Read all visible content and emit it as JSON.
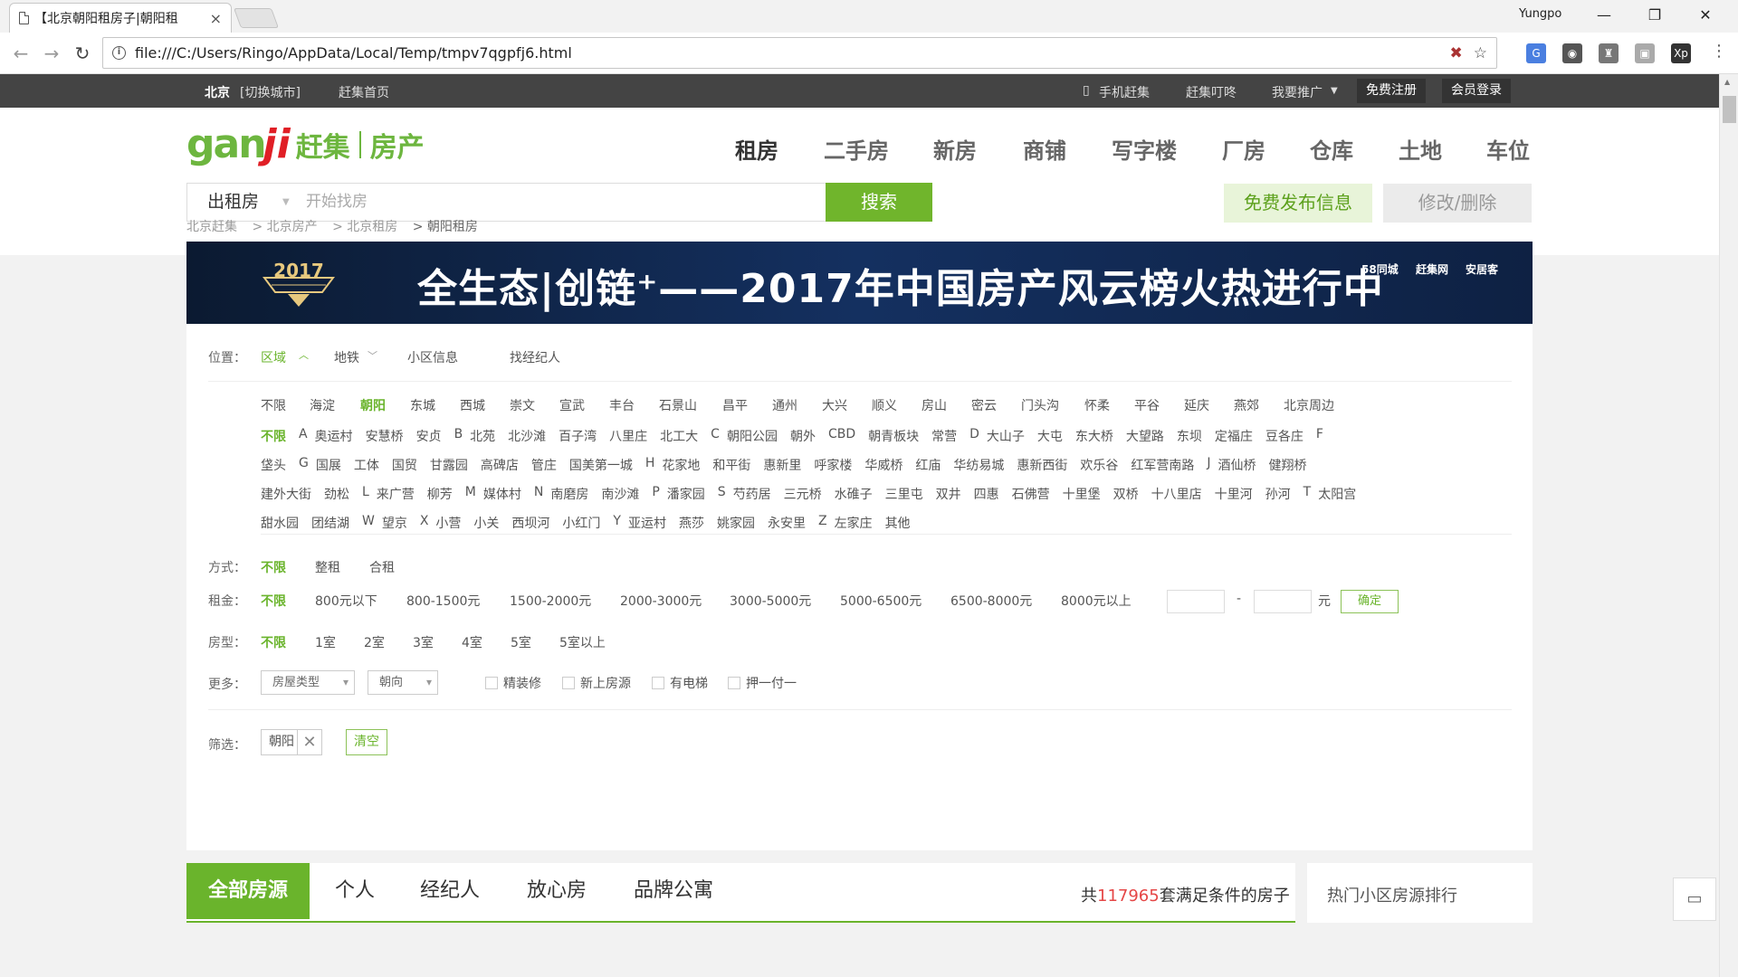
{
  "browser": {
    "tab_title": "【北京朝阳租房子|朝阳租",
    "tab_close": "×",
    "user": "Yungpo",
    "minimize": "—",
    "restore": "❐",
    "close": "✕",
    "url": "file:///C:/Users/Ringo/AppData/Local/Temp/tmpv7qgpfj6.html",
    "icons": [
      "back-icon",
      "forward-icon",
      "reload-icon",
      "info-icon",
      "blocked-plugin-icon",
      "bookmark-star-icon",
      "translate-icon",
      "extension-icon",
      "menu-icon"
    ]
  },
  "topbar": {
    "city": "北京",
    "switch_city": "[切换城市]",
    "home": "赶集首页",
    "mobile": "手机赶集",
    "dingdong": "赶集叮咚",
    "promote": "我要推广",
    "register": "免费注册",
    "login": "会员登录"
  },
  "logo": {
    "gan": "gan",
    "ji": "ji",
    "ganji": "赶集",
    "fangchan": "房产"
  },
  "main_nav": [
    "租房",
    "二手房",
    "新房",
    "商铺",
    "写字楼",
    "厂房",
    "仓库",
    "土地",
    "车位"
  ],
  "search": {
    "type": "出租房",
    "placeholder": "开始找房",
    "button": "搜索",
    "publish": "免费发布信息",
    "edit": "修改/删除"
  },
  "breadcrumb": [
    "北京赶集",
    "> 北京房产",
    "> 北京租房",
    "> 朝阳租房"
  ],
  "banner": {
    "year": "2017",
    "main": "全生态|创链⁺——2017年中国房产风云榜火热进行中",
    "logos": [
      "58同城",
      "赶集网",
      "安居客"
    ]
  },
  "filters": {
    "location_label": "位置：",
    "location_tabs": [
      "区域",
      "地铁",
      "小区信息",
      "找经纪人"
    ],
    "districts": [
      "不限",
      "海淀",
      "朝阳",
      "东城",
      "西城",
      "崇文",
      "宣武",
      "丰台",
      "石景山",
      "昌平",
      "通州",
      "大兴",
      "顺义",
      "房山",
      "密云",
      "门头沟",
      "怀柔",
      "平谷",
      "延庆",
      "燕郊",
      "北京周边"
    ],
    "area_rows": [
      [
        "不限",
        "A",
        "奥运村",
        "安慧桥",
        "安贞",
        "B",
        "北苑",
        "北沙滩",
        "百子湾",
        "八里庄",
        "北工大",
        "C",
        "朝阳公园",
        "朝外",
        "CBD",
        "朝青板块",
        "常营",
        "D",
        "大山子",
        "大屯",
        "东大桥",
        "大望路",
        "东坝",
        "定福庄",
        "豆各庄",
        "F"
      ],
      [
        "垡头",
        "G",
        "国展",
        "工体",
        "国贸",
        "甘露园",
        "高碑店",
        "管庄",
        "国美第一城",
        "H",
        "花家地",
        "和平街",
        "惠新里",
        "呼家楼",
        "华威桥",
        "红庙",
        "华纺易城",
        "惠新西街",
        "欢乐谷",
        "红军营南路",
        "J",
        "酒仙桥",
        "健翔桥"
      ],
      [
        "建外大街",
        "劲松",
        "L",
        "来广营",
        "柳芳",
        "M",
        "媒体村",
        "N",
        "南磨房",
        "南沙滩",
        "P",
        "潘家园",
        "S",
        "芍药居",
        "三元桥",
        "水碓子",
        "三里屯",
        "双井",
        "四惠",
        "石佛营",
        "十里堡",
        "双桥",
        "十八里店",
        "十里河",
        "孙河",
        "T",
        "太阳宫"
      ],
      [
        "甜水园",
        "团结湖",
        "W",
        "望京",
        "X",
        "小营",
        "小关",
        "西坝河",
        "小红门",
        "Y",
        "亚运村",
        "燕莎",
        "姚家园",
        "永安里",
        "Z",
        "左家庄",
        "其他"
      ]
    ],
    "mode_label": "方式：",
    "modes": [
      "不限",
      "整租",
      "合租"
    ],
    "rent_label": "租金：",
    "rents": [
      "不限",
      "800元以下",
      "800-1500元",
      "1500-2000元",
      "2000-3000元",
      "3000-5000元",
      "5000-6500元",
      "6500-8000元",
      "8000元以上"
    ],
    "rent_dash": "-",
    "rent_unit": "元",
    "rent_confirm": "确定",
    "room_label": "房型：",
    "rooms": [
      "不限",
      "1室",
      "2室",
      "3室",
      "4室",
      "5室",
      "5室以上"
    ],
    "more_label": "更多：",
    "selects": [
      "房屋类型",
      "朝向"
    ],
    "checks": [
      "精装修",
      "新上房源",
      "有电梯",
      "押一付一"
    ],
    "chosen_label": "筛选：",
    "chosen_tag": "朝阳",
    "chosen_remove": "✕",
    "clear": "清空"
  },
  "list_tabs": [
    "全部房源",
    "个人",
    "经纪人",
    "放心房",
    "品牌公寓"
  ],
  "count": {
    "prefix": "共",
    "number": "117965",
    "suffix": "套满足条件的房子"
  },
  "hot": "热门小区房源排行",
  "colors": {
    "accent": "#6ab42c",
    "logo_red": "#e01f26",
    "highlight": "#e54646"
  }
}
